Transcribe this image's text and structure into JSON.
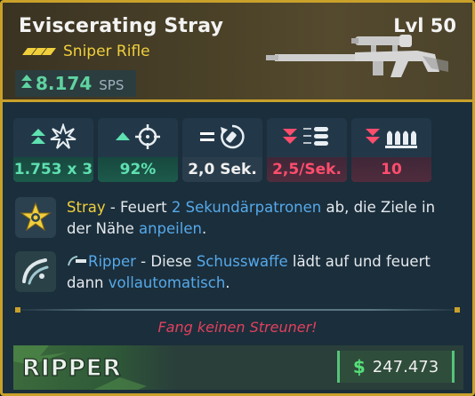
{
  "weapon": {
    "name": "Eviscerating Stray",
    "level": "Lvl 50",
    "type": "Sniper Rifle",
    "sps_value": "8.174",
    "sps_unit": "SPS",
    "rarity_color": "#f0cf3d"
  },
  "stats": [
    {
      "icon": "damage-burst-icon",
      "value": "1.753 x 3",
      "trend": "up"
    },
    {
      "icon": "crosshair-icon",
      "value": "92%",
      "trend": "up"
    },
    {
      "icon": "reload-icon",
      "value": "2,0 Sek.",
      "trend": "equal"
    },
    {
      "icon": "fire-rate-icon",
      "value": "2,5/Sek.",
      "trend": "down"
    },
    {
      "icon": "ammo-icon",
      "value": "10",
      "trend": "down"
    }
  ],
  "perks": [
    {
      "icon": "stray-perk-icon",
      "title": "Stray",
      "t1": " - Feuert ",
      "h1": "2 Sekundärpatronen",
      "t2": " ab, die Ziele in der Nähe ",
      "h2": "anpeilen",
      "t3": "."
    },
    {
      "icon": "ripper-perk-icon",
      "title": "Ripper",
      "t1": " - Diese ",
      "h1": "Schusswaffe",
      "t2": " lädt auf und feuert dann ",
      "h2": "vollautomatisch",
      "t3": "."
    }
  ],
  "flavor_text": "Fang keinen Streuner!",
  "footer": {
    "manufacturer_logo_text": "RIPPER",
    "price": "247.473",
    "currency_icon": "dollar-icon"
  },
  "colors": {
    "rarity_gold": "#c9a12a",
    "positive": "#5fe0b0",
    "negative": "#ff4d6d",
    "highlight_blue": "#55a9ea"
  }
}
